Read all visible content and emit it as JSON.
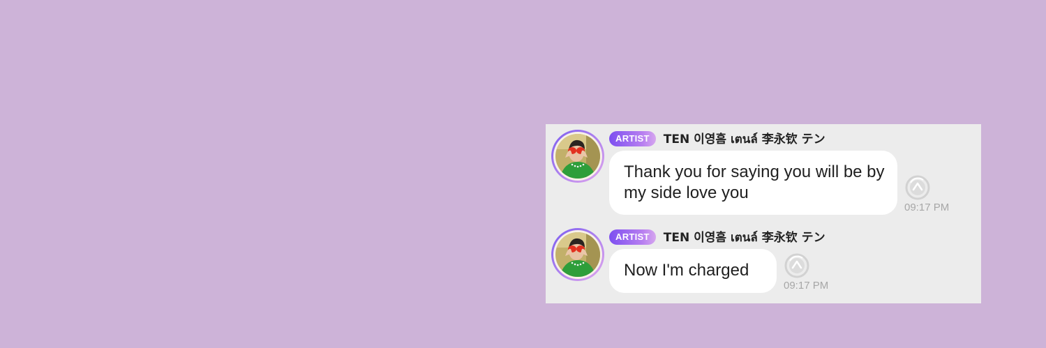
{
  "colors": {
    "background": "#cdb3d8",
    "panel": "#ececec",
    "badge_start": "#7d4ff0",
    "badge_end": "#d6a6ef",
    "bubble": "#ffffff",
    "time_text": "#a7a7a7"
  },
  "messages": [
    {
      "badge": "ARTIST",
      "sender": "TEN 이영흠 เตนล์ 李永钦 テン",
      "text": "Thank you for saying you will be by my side love you",
      "time": "09:17 PM",
      "status_icon": "replay-icon"
    },
    {
      "badge": "ARTIST",
      "sender": "TEN 이영흠 เตนล์ 李永钦 テン",
      "text": "Now I'm charged",
      "time": "09:17 PM",
      "status_icon": "replay-icon"
    }
  ]
}
